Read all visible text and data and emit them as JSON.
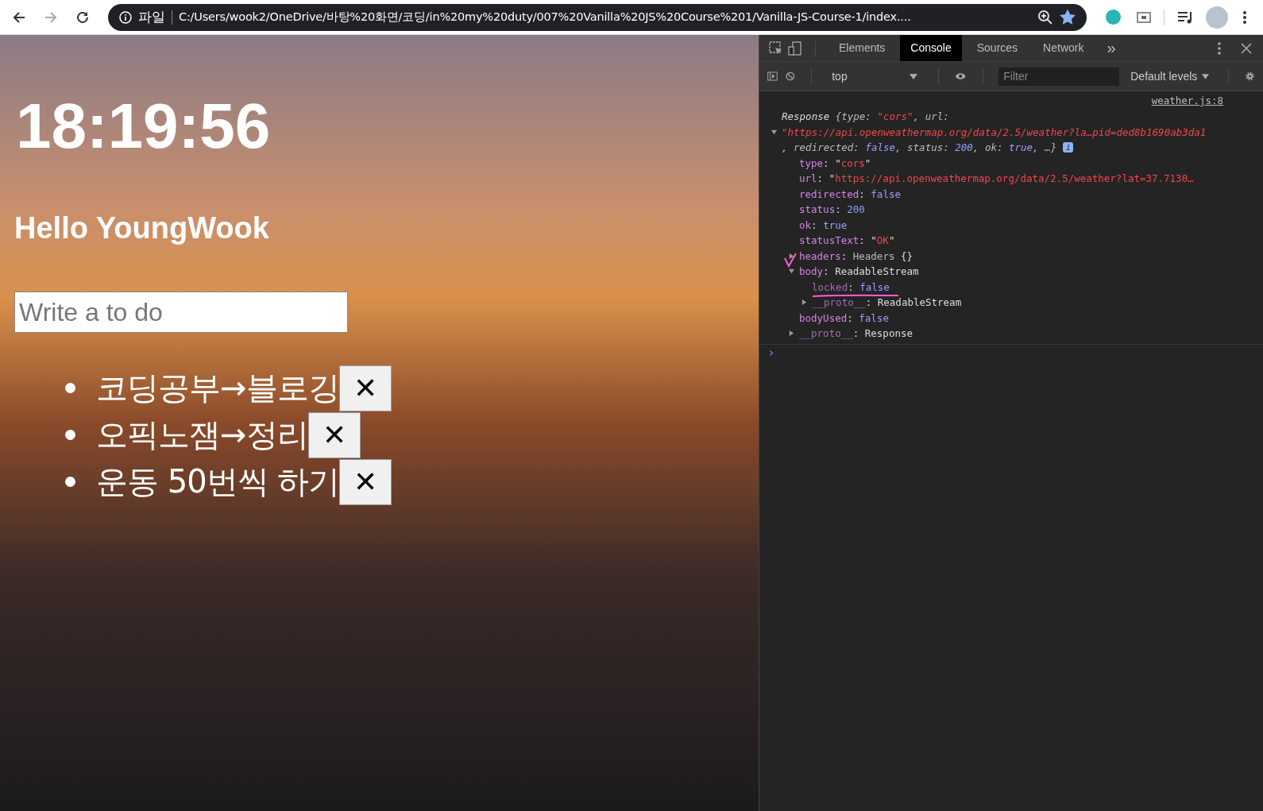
{
  "browser": {
    "scheme_label": "파일",
    "url": "C:/Users/wook2/OneDrive/바탕%20화면/코딩/in%20my%20duty/007%20Vanilla%20JS%20Course%201/Vanilla-JS-Course-1/index....",
    "bookmarked": true
  },
  "page": {
    "clock": "18:19:56",
    "greeting": "Hello YoungWook",
    "todo_input": {
      "placeholder": "Write a to do"
    },
    "todos": [
      {
        "text": "코딩공부→블로깅",
        "delete_label": "✕"
      },
      {
        "text": "오픽노잼→정리",
        "delete_label": "✕"
      },
      {
        "text": "운동 50번씩 하기",
        "delete_label": "✕"
      }
    ]
  },
  "devtools": {
    "tabs": [
      {
        "label": "Elements",
        "selected": false
      },
      {
        "label": "Console",
        "selected": true
      },
      {
        "label": "Sources",
        "selected": false
      },
      {
        "label": "Network",
        "selected": false
      }
    ],
    "more_tabs": "»",
    "context": "top",
    "filter": {
      "placeholder": "Filter"
    },
    "levels": "Default levels",
    "console": {
      "entries": [
        {
          "source": "weather.js:8",
          "expanded": true,
          "summary": [
            [
              {
                "text": "Response ",
                "kind": "plain"
              },
              {
                "text": "{type: ",
                "kind": "dim"
              },
              {
                "text": "\"cors\"",
                "kind": "string"
              },
              {
                "text": ", url:",
                "kind": "dim"
              }
            ],
            [
              {
                "text": "\"https://api.openweathermap.org/data/2.5/weather?la…pid=ded8b1690ab3da1",
                "kind": "string"
              }
            ],
            [
              {
                "text": ", redirected: ",
                "kind": "dim"
              },
              {
                "text": "false",
                "kind": "keyword"
              },
              {
                "text": ", status: ",
                "kind": "dim"
              },
              {
                "text": "200",
                "kind": "keyword"
              },
              {
                "text": ", ok: ",
                "kind": "dim"
              },
              {
                "text": "true",
                "kind": "keyword"
              },
              {
                "text": ", …}",
                "kind": "dim"
              }
            ]
          ],
          "info_badge": "i",
          "children": [
            {
              "key": "type",
              "enumerable": true,
              "value": [
                {
                  "text": ": \"",
                  "kind": "plain"
                },
                {
                  "text": "cors",
                  "kind": "string"
                },
                {
                  "text": "\"",
                  "kind": "plain"
                }
              ]
            },
            {
              "key": "url",
              "enumerable": true,
              "value": [
                {
                  "text": ": \"",
                  "kind": "plain"
                },
                {
                  "text": "https://api.openweathermap.org/data/2.5/weather?lat=37.7130…",
                  "kind": "string"
                }
              ]
            },
            {
              "key": "redirected",
              "enumerable": true,
              "value": [
                {
                  "text": ": ",
                  "kind": "plain"
                },
                {
                  "text": "false",
                  "kind": "keyword"
                }
              ]
            },
            {
              "key": "status",
              "enumerable": true,
              "value": [
                {
                  "text": ": ",
                  "kind": "plain"
                },
                {
                  "text": "200",
                  "kind": "keyword"
                }
              ]
            },
            {
              "key": "ok",
              "enumerable": true,
              "value": [
                {
                  "text": ": ",
                  "kind": "plain"
                },
                {
                  "text": "true",
                  "kind": "keyword"
                }
              ]
            },
            {
              "key": "statusText",
              "enumerable": true,
              "value": [
                {
                  "text": ": \"",
                  "kind": "plain"
                },
                {
                  "text": "OK",
                  "kind": "string"
                },
                {
                  "text": "\"",
                  "kind": "plain"
                }
              ]
            },
            {
              "key": "headers",
              "enumerable": true,
              "expanded": false,
              "value": [
                {
                  "text": ": ",
                  "kind": "plain"
                },
                {
                  "text": "Headers ",
                  "kind": "dim"
                },
                {
                  "text": "{}",
                  "kind": "plain"
                }
              ]
            },
            {
              "key": "body",
              "enumerable": true,
              "expanded": true,
              "value": [
                {
                  "text": ": ",
                  "kind": "plain"
                },
                {
                  "text": "ReadableStream",
                  "kind": "plain"
                }
              ],
              "children": [
                {
                  "key": "locked",
                  "enumerable": false,
                  "value": [
                    {
                      "text": ": ",
                      "kind": "plain"
                    },
                    {
                      "text": "false",
                      "kind": "keyword"
                    }
                  ]
                },
                {
                  "key": "__proto__",
                  "enumerable": false,
                  "expanded": false,
                  "value": [
                    {
                      "text": ": ",
                      "kind": "plain"
                    },
                    {
                      "text": "ReadableStream",
                      "kind": "plain"
                    }
                  ]
                }
              ]
            },
            {
              "key": "bodyUsed",
              "enumerable": true,
              "value": [
                {
                  "text": ": ",
                  "kind": "plain"
                },
                {
                  "text": "false",
                  "kind": "keyword"
                }
              ]
            },
            {
              "key": "__proto__",
              "enumerable": false,
              "expanded": false,
              "value": [
                {
                  "text": ": ",
                  "kind": "plain"
                },
                {
                  "text": "Response",
                  "kind": "plain"
                }
              ]
            }
          ]
        }
      ],
      "prompt": "›"
    }
  }
}
